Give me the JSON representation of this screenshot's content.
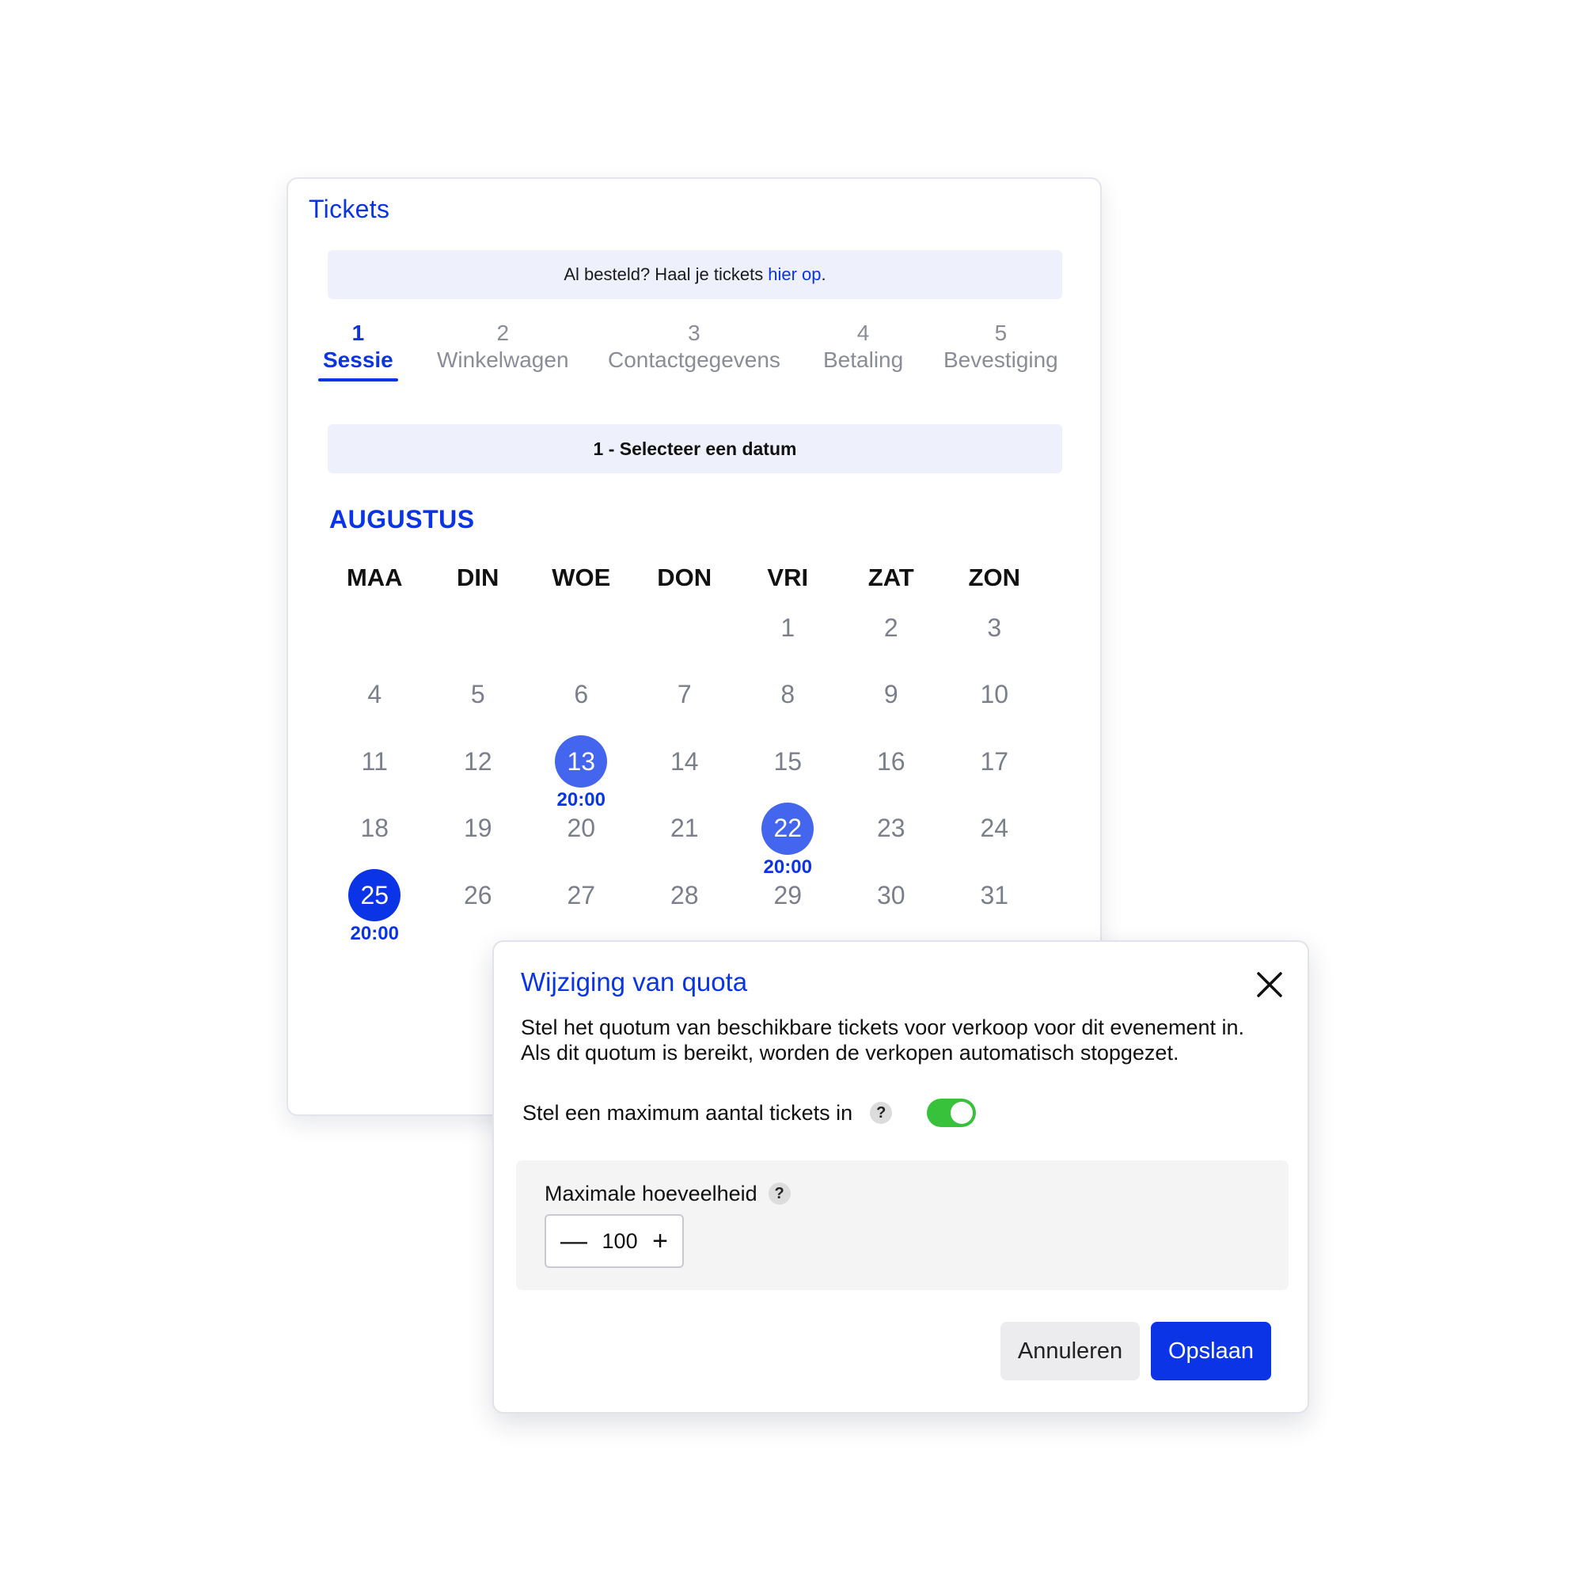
{
  "tickets": {
    "title": "Tickets",
    "banner": {
      "text": "Al besteld? Haal je tickets",
      "link": "hier op",
      "suffix": "."
    },
    "steps": [
      {
        "num": "1",
        "label": "Sessie"
      },
      {
        "num": "2",
        "label": "Winkelwagen"
      },
      {
        "num": "3",
        "label": "Contactgegevens"
      },
      {
        "num": "4",
        "label": "Betaling"
      },
      {
        "num": "5",
        "label": "Bevestiging"
      }
    ],
    "active_step": 1,
    "section_label": "1 - Selecteer een datum",
    "month": "AUGUSTUS",
    "weekdays": [
      "MAA",
      "DIN",
      "WOE",
      "DON",
      "VRI",
      "ZAT",
      "ZON"
    ],
    "leading_blanks": 4,
    "days_in_month": 31,
    "sessions": [
      {
        "day": "13",
        "time": "20:00"
      },
      {
        "day": "22",
        "time": "20:00"
      },
      {
        "day": "25",
        "time": "20:00"
      }
    ],
    "selected_day": "25"
  },
  "modal": {
    "title": "Wijziging van quota",
    "description": "Stel het quotum van beschikbare tickets voor verkoop voor dit evenement in. Als dit quotum is bereikt, worden de verkopen automatisch stopgezet.",
    "toggle_label": "Stel een maximum aantal tickets in",
    "toggle_on": true,
    "help_glyph": "?",
    "quantity_label": "Maximale hoeveelheid",
    "quantity_value": "100",
    "minus_glyph": "—",
    "plus_glyph": "+",
    "cancel_label": "Annuleren",
    "save_label": "Opslaan"
  },
  "colors": {
    "accent": "#0a34e6",
    "session": "#4466ee",
    "toggle": "#38c23c"
  },
  "icons": {
    "close": "close-icon",
    "help": "help-icon",
    "minus": "minus-icon",
    "plus": "plus-icon"
  }
}
